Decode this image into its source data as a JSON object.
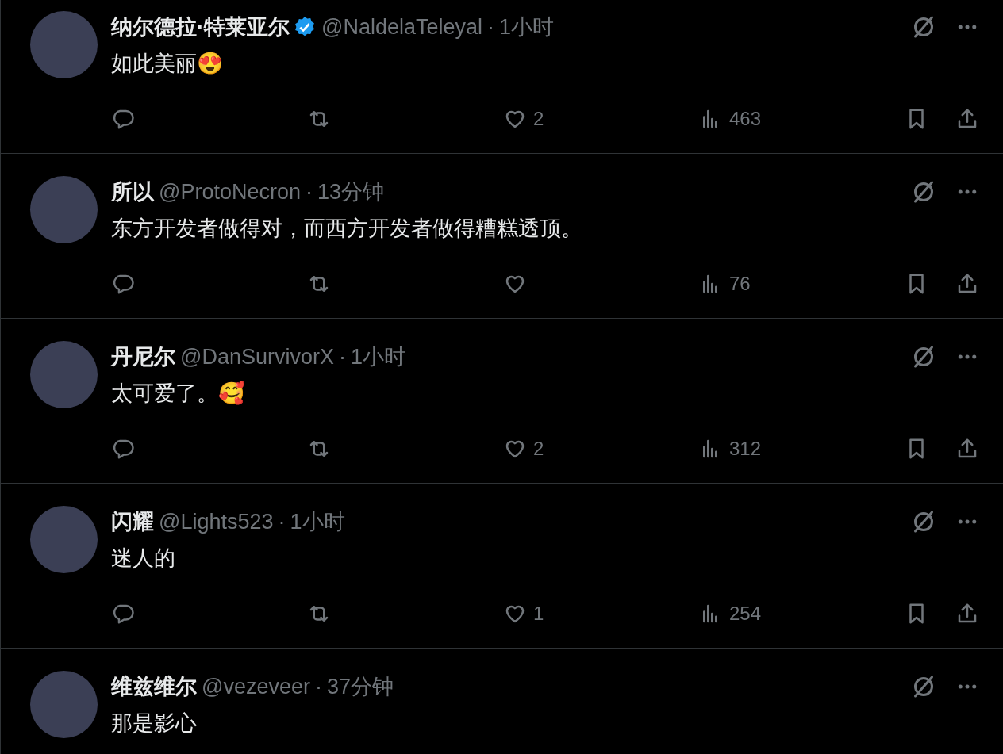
{
  "replies": [
    {
      "name": "纳尔德拉·特莱亚尔",
      "verified": true,
      "handle": "@NaldelaTeleyal",
      "separator": "·",
      "time": "1小时",
      "text": "如此美丽😍",
      "actions": {
        "likes": "2",
        "views": "463"
      }
    },
    {
      "name": "所以",
      "verified": false,
      "handle": "@ProtoNecron",
      "separator": "·",
      "time": "13分钟",
      "text": "东方开发者做得对，而西方开发者做得糟糕透顶。",
      "actions": {
        "views": "76"
      }
    },
    {
      "name": "丹尼尔",
      "verified": false,
      "handle": "@DanSurvivorX",
      "separator": "·",
      "time": "1小时",
      "text": "太可爱了。🥰",
      "actions": {
        "likes": "2",
        "views": "312"
      }
    },
    {
      "name": "闪耀",
      "verified": false,
      "handle": "@Lights523",
      "separator": "·",
      "time": "1小时",
      "text": "迷人的",
      "actions": {
        "likes": "1",
        "views": "254"
      }
    },
    {
      "name": "维兹维尔",
      "verified": false,
      "handle": "@vezeveer",
      "separator": "·",
      "time": "37分钟",
      "text": "那是影心"
    }
  ]
}
